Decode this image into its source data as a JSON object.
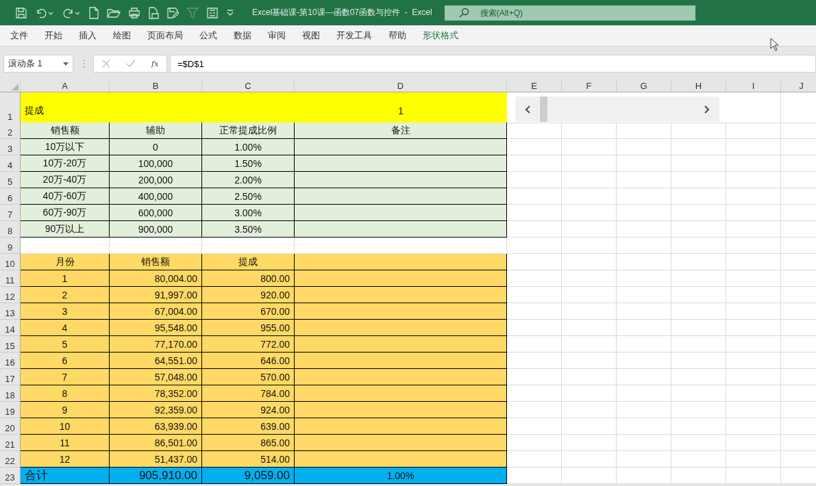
{
  "window": {
    "title": "Excel基础课-第10课---函数07函数与控件  -  Excel",
    "search": {
      "placeholder": "搜索(Alt+Q)"
    }
  },
  "menu": [
    {
      "label": "文件",
      "kind": "normal"
    },
    {
      "label": "开始",
      "kind": "normal"
    },
    {
      "label": "插入",
      "kind": "normal"
    },
    {
      "label": "绘图",
      "kind": "normal"
    },
    {
      "label": "页面布局",
      "kind": "normal"
    },
    {
      "label": "公式",
      "kind": "normal"
    },
    {
      "label": "数据",
      "kind": "normal"
    },
    {
      "label": "审阅",
      "kind": "normal"
    },
    {
      "label": "视图",
      "kind": "normal"
    },
    {
      "label": "开发工具",
      "kind": "normal"
    },
    {
      "label": "帮助",
      "kind": "normal"
    },
    {
      "label": "形状格式",
      "kind": "contextual"
    }
  ],
  "formula_bar": {
    "name_box": "滚动条 1",
    "function_label": "fx",
    "formula": "=$D$1"
  },
  "sheet": {
    "columns": [
      "A",
      "B",
      "C",
      "D",
      "E",
      "F",
      "G",
      "H",
      "I",
      "J"
    ],
    "rows": [
      {
        "number": "1",
        "kind": "title",
        "cells": [
          "提成",
          "",
          "",
          "1"
        ]
      },
      {
        "number": "2",
        "kind": "rate",
        "cells": [
          "销售额",
          "辅助",
          "正常提成比例",
          "备注"
        ]
      },
      {
        "number": "3",
        "kind": "rate",
        "cells": [
          "10万以下",
          "0",
          "1.00%"
        ]
      },
      {
        "number": "4",
        "kind": "rate",
        "cells": [
          "10万-20万",
          "100,000",
          "1.50%"
        ]
      },
      {
        "number": "5",
        "kind": "rate",
        "cells": [
          "20万-40万",
          "200,000",
          "2.00%"
        ]
      },
      {
        "number": "6",
        "kind": "rate",
        "cells": [
          "40万-60万",
          "400,000",
          "2.50%"
        ]
      },
      {
        "number": "7",
        "kind": "rate",
        "cells": [
          "60万-90万",
          "600,000",
          "3.00%"
        ]
      },
      {
        "number": "8",
        "kind": "rate",
        "cells": [
          "90万以上",
          "900,000",
          "3.50%"
        ]
      },
      {
        "number": "9",
        "kind": "blank",
        "cells": []
      },
      {
        "number": "10",
        "kind": "month_header",
        "cells": [
          "月份",
          "销售额",
          "提成"
        ]
      },
      {
        "number": "11",
        "kind": "month",
        "cells": [
          "1",
          "80,004.00",
          "800.00"
        ]
      },
      {
        "number": "12",
        "kind": "month",
        "cells": [
          "2",
          "91,997.00",
          "920.00"
        ]
      },
      {
        "number": "13",
        "kind": "month",
        "cells": [
          "3",
          "67,004.00",
          "670.00"
        ]
      },
      {
        "number": "14",
        "kind": "month",
        "cells": [
          "4",
          "95,548.00",
          "955.00"
        ]
      },
      {
        "number": "15",
        "kind": "month",
        "cells": [
          "5",
          "77,170.00",
          "772.00"
        ]
      },
      {
        "number": "16",
        "kind": "month",
        "cells": [
          "6",
          "64,551.00",
          "646.00"
        ]
      },
      {
        "number": "17",
        "kind": "month",
        "cells": [
          "7",
          "57,048.00",
          "570.00"
        ]
      },
      {
        "number": "18",
        "kind": "month",
        "cells": [
          "8",
          "78,352.00",
          "784.00"
        ]
      },
      {
        "number": "19",
        "kind": "month",
        "cells": [
          "9",
          "92,359.00",
          "924.00"
        ]
      },
      {
        "number": "20",
        "kind": "month",
        "cells": [
          "10",
          "63,939.00",
          "639.00"
        ]
      },
      {
        "number": "21",
        "kind": "month",
        "cells": [
          "11",
          "86,501.00",
          "865.00"
        ]
      },
      {
        "number": "22",
        "kind": "month",
        "cells": [
          "12",
          "51,437.00",
          "514.00"
        ]
      },
      {
        "number": "23",
        "kind": "total",
        "cells": [
          "合计",
          "905,910.00",
          "9,059.00",
          "1.00%"
        ]
      }
    ]
  }
}
